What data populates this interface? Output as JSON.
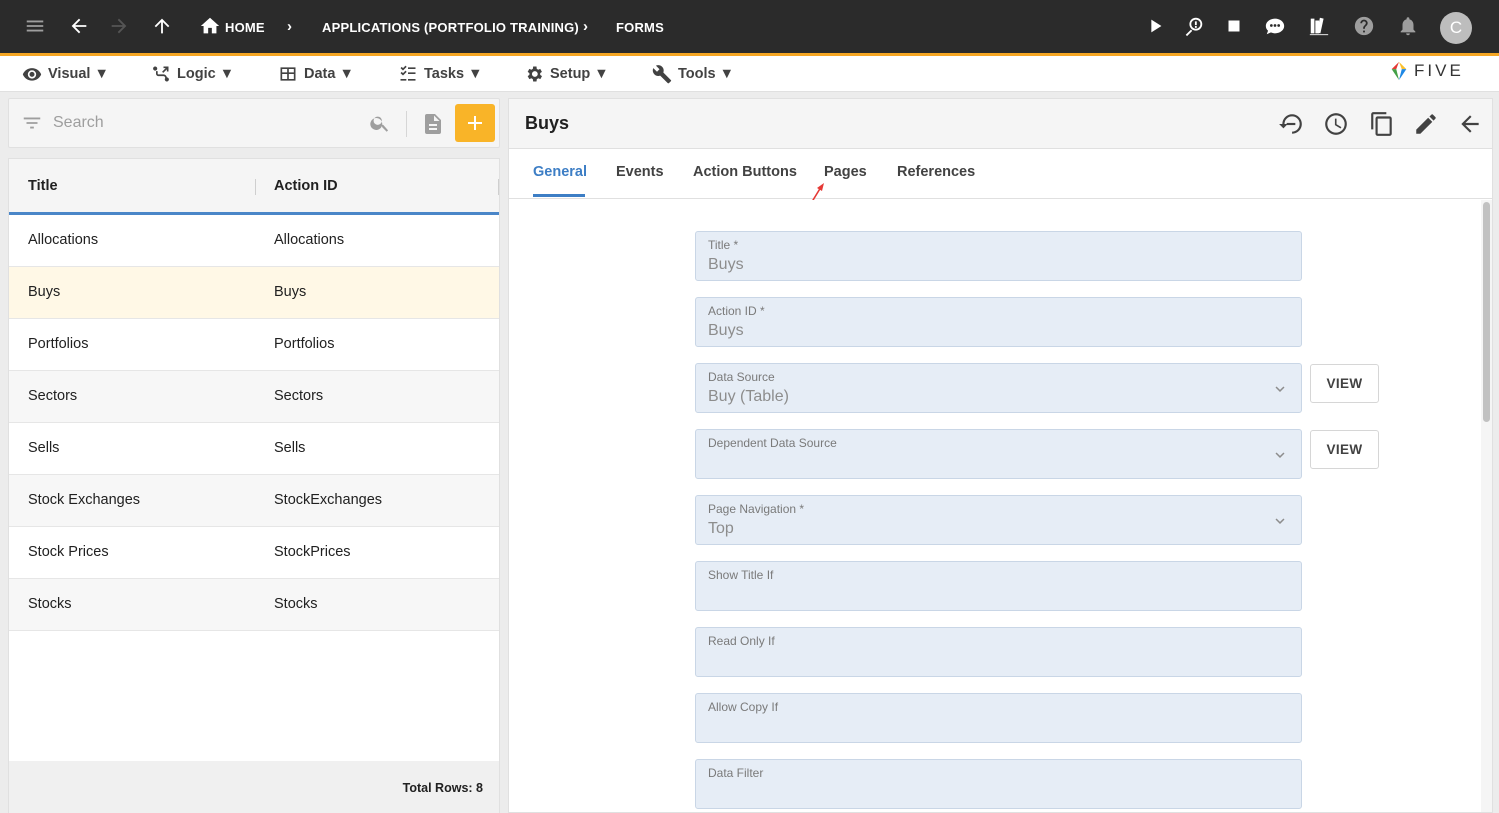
{
  "topbar": {
    "breadcrumbs": [
      "HOME",
      "APPLICATIONS (PORTFOLIO TRAINING)",
      "FORMS"
    ],
    "avatar_initial": "C",
    "accent_color": "#f5a623"
  },
  "menubar": {
    "items": [
      {
        "label": "Visual ▼",
        "icon": "eye-icon"
      },
      {
        "label": "Logic ▼",
        "icon": "logic-icon"
      },
      {
        "label": "Data ▼",
        "icon": "table-icon"
      },
      {
        "label": "Tasks ▼",
        "icon": "tasks-icon"
      },
      {
        "label": "Setup ▼",
        "icon": "gear-icon"
      },
      {
        "label": "Tools ▼",
        "icon": "tools-icon"
      }
    ],
    "logo_text": "FIVE"
  },
  "left": {
    "search_placeholder": "Search",
    "columns": [
      "Title",
      "Action ID"
    ],
    "rows": [
      {
        "title": "Allocations",
        "action_id": "Allocations"
      },
      {
        "title": "Buys",
        "action_id": "Buys"
      },
      {
        "title": "Portfolios",
        "action_id": "Portfolios"
      },
      {
        "title": "Sectors",
        "action_id": "Sectors"
      },
      {
        "title": "Sells",
        "action_id": "Sells"
      },
      {
        "title": "Stock Exchanges",
        "action_id": "StockExchanges"
      },
      {
        "title": "Stock Prices",
        "action_id": "StockPrices"
      },
      {
        "title": "Stocks",
        "action_id": "Stocks"
      }
    ],
    "selected_row": 1,
    "total_rows": "Total Rows: 8"
  },
  "right": {
    "title": "Buys",
    "tabs": [
      "General",
      "Events",
      "Action Buttons",
      "Pages",
      "References"
    ],
    "active_tab": "General",
    "fields": [
      {
        "label": "Title *",
        "value": "Buys",
        "dropdown": false
      },
      {
        "label": "Action ID *",
        "value": "Buys",
        "dropdown": false
      },
      {
        "label": "Data Source",
        "value": "Buy (Table)",
        "dropdown": true,
        "view": "VIEW"
      },
      {
        "label": "Dependent Data Source",
        "value": "",
        "dropdown": true,
        "view": "VIEW"
      },
      {
        "label": "Page Navigation *",
        "value": "Top",
        "dropdown": true
      },
      {
        "label": "Show Title If",
        "value": "",
        "dropdown": false
      },
      {
        "label": "Read Only If",
        "value": "",
        "dropdown": false
      },
      {
        "label": "Allow Copy If",
        "value": "",
        "dropdown": false
      },
      {
        "label": "Data Filter",
        "value": "",
        "dropdown": false
      }
    ]
  }
}
